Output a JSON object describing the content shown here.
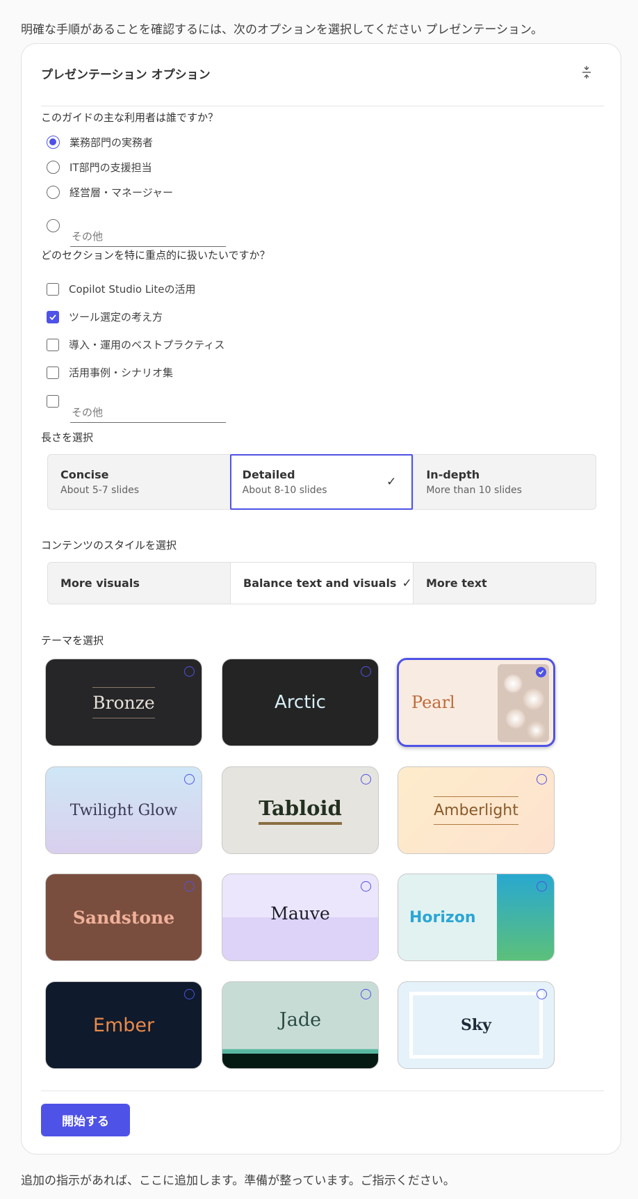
{
  "intro_text": "明確な手順があることを確認するには、次のオプションを選択してください プレゼンテーション。",
  "card": {
    "title": "プレゼンテーション オプション",
    "collapse_icon": "collapse-icon"
  },
  "audience": {
    "question": "このガイドの主な利用者は誰ですか？",
    "options": [
      {
        "label": "業務部門の実務者",
        "selected": true
      },
      {
        "label": "IT部門の支援担当",
        "selected": false
      },
      {
        "label": "経営層・マネージャー",
        "selected": false
      }
    ],
    "other_placeholder": "その他",
    "other_value": ""
  },
  "sections": {
    "question": "どのセクションを特に重点的に扱いたいですか？",
    "options": [
      {
        "label": "Copilot Studio Liteの活用",
        "checked": false
      },
      {
        "label": "ツール選定の考え方",
        "checked": true
      },
      {
        "label": "導入・運用のベストプラクティス",
        "checked": false
      },
      {
        "label": "活用事例・シナリオ集",
        "checked": false
      }
    ],
    "other_placeholder": "その他",
    "other_value": ""
  },
  "length": {
    "label": "長さを選択",
    "options": [
      {
        "label": "Concise",
        "sub": "About 5-7 slides",
        "selected": false
      },
      {
        "label": "Detailed",
        "sub": "About 8-10 slides",
        "selected": true
      },
      {
        "label": "In-depth",
        "sub": "More than 10 slides",
        "selected": false
      }
    ]
  },
  "style": {
    "label": "コンテンツのスタイルを選択",
    "options": [
      {
        "label": "More visuals",
        "selected": false
      },
      {
        "label": "Balance text and visuals",
        "selected": true
      },
      {
        "label": "More text",
        "selected": false
      }
    ]
  },
  "themes": {
    "label": "テーマを選択",
    "items": [
      {
        "name": "Bronze",
        "selected": false
      },
      {
        "name": "Arctic",
        "selected": false
      },
      {
        "name": "Pearl",
        "selected": true
      },
      {
        "name": "Twilight Glow",
        "selected": false
      },
      {
        "name": "Tabloid",
        "selected": false
      },
      {
        "name": "Amberlight",
        "selected": false
      },
      {
        "name": "Sandstone",
        "selected": false
      },
      {
        "name": "Mauve",
        "selected": false
      },
      {
        "name": "Horizon",
        "selected": false
      },
      {
        "name": "Ember",
        "selected": false
      },
      {
        "name": "Jade",
        "selected": false
      },
      {
        "name": "Sky",
        "selected": false
      }
    ]
  },
  "start_button": "開始する",
  "footer_text": "追加の指示があれば、ここに追加します。準備が整っています。ご指示ください。",
  "colors": {
    "accent": "#4f52e6",
    "card_border": "#e1e1e1",
    "page_bg": "#fafafa"
  }
}
